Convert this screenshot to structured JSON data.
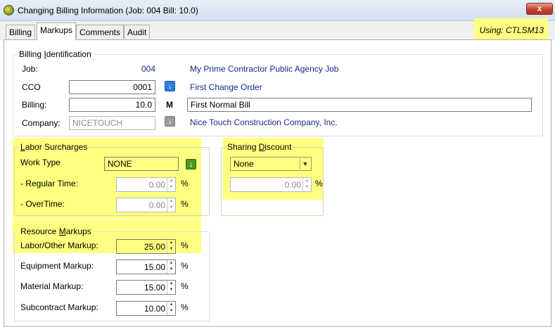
{
  "window": {
    "title": "Changing Billing Information  (Job: 004  Bill:   10.0)",
    "close_glyph": "x"
  },
  "tabs": [
    {
      "label": "Billing"
    },
    {
      "label": "Markups"
    },
    {
      "label": "Comments"
    },
    {
      "label": "Audit"
    }
  ],
  "using_label": "Using: CTLSM13",
  "billing_identification": {
    "legend_pre": "Billing ",
    "legend_u": "I",
    "legend_post": "dentification",
    "job_label": "Job:",
    "job_value": "004",
    "job_name": "My Prime Contractor Public Agency Job",
    "cco_label": "CCO",
    "cco_value": "0001",
    "cco_name": "First Change Order",
    "billing_label": "Billing:",
    "billing_value": "10.0",
    "billing_m": "M",
    "billing_desc": "First Normal Bill",
    "company_label": "Company:",
    "company_value": "NICETOUCH",
    "company_name": "Nice Touch Construction Company, Inc.",
    "select_icon": "blue-down-arrow-icon",
    "company_icon": "gray-down-arrow-icon"
  },
  "labor_surcharges": {
    "legend_u": "L",
    "legend_rest": "abor Surcharges",
    "work_type_label": "Work Type",
    "work_type_value": "NONE",
    "work_type_icon": "green-down-arrow-icon",
    "regular_label": " - Regular Time:",
    "regular_value": "0.00",
    "overtime_label": " - OverTime:",
    "overtime_value": "0.00",
    "pct": "%"
  },
  "sharing_discount": {
    "legend_pre": "Sharing ",
    "legend_u": "D",
    "legend_post": "iscount",
    "select_value": "None",
    "value": "0.00",
    "pct": "%"
  },
  "resource_markups": {
    "legend_pre": "Resource ",
    "legend_u": "M",
    "legend_post": "arkups",
    "labor_label": "Labor/Other Markup:",
    "labor_value": "25.00",
    "equipment_label": "Equipment Markup:",
    "equipment_value": "15.00",
    "material_label": "Material Markup:",
    "material_value": "15.00",
    "subcontract_label": "Subcontract Markup:",
    "subcontract_value": "10.00",
    "pct": "%"
  },
  "colors": {
    "highlight": "#ffff80",
    "link_blue": "#1b2a8a"
  }
}
